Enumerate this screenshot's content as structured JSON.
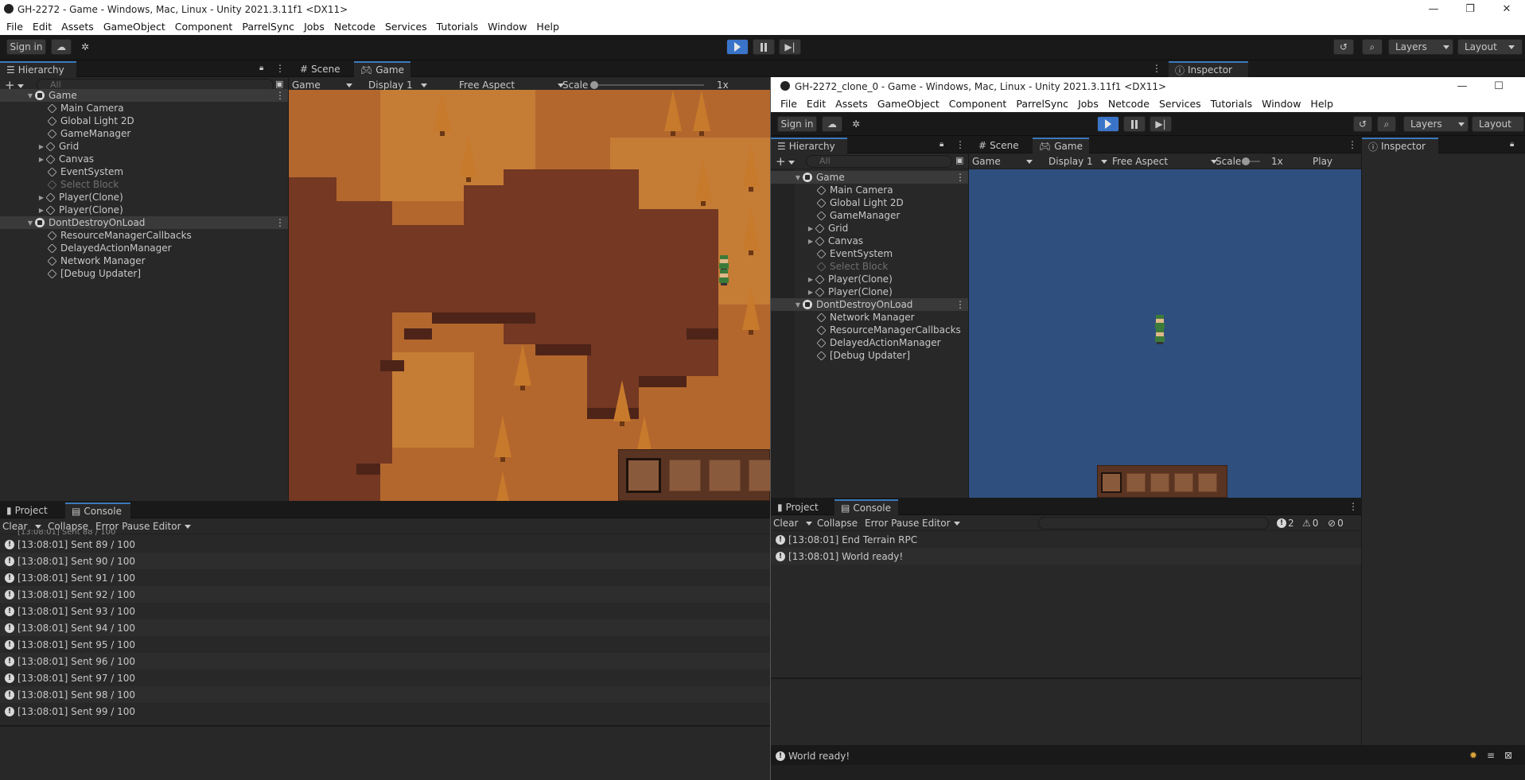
{
  "main_window": {
    "title": "GH-2272 - Game - Windows, Mac, Linux - Unity 2021.3.11f1 <DX11>",
    "menu": [
      "File",
      "Edit",
      "Assets",
      "GameObject",
      "Component",
      "ParrelSync",
      "Jobs",
      "Netcode",
      "Services",
      "Tutorials",
      "Window",
      "Help"
    ],
    "toolbar": {
      "sign_in": "Sign in",
      "layers": "Layers",
      "layout": "Layout"
    },
    "hierarchy": {
      "tab": "Hierarchy",
      "search_placeholder": "All",
      "items": [
        {
          "label": "Game",
          "kind": "scene",
          "expanded": true
        },
        {
          "label": "Main Camera",
          "kind": "object"
        },
        {
          "label": "Global Light 2D",
          "kind": "object"
        },
        {
          "label": "GameManager",
          "kind": "object"
        },
        {
          "label": "Grid",
          "kind": "object",
          "has_children": true
        },
        {
          "label": "Canvas",
          "kind": "object",
          "has_children": true
        },
        {
          "label": "EventSystem",
          "kind": "object"
        },
        {
          "label": "Select Block",
          "kind": "object",
          "disabled": true
        },
        {
          "label": "Player(Clone)",
          "kind": "object",
          "has_children": true
        },
        {
          "label": "Player(Clone)",
          "kind": "object",
          "has_children": true
        },
        {
          "label": "DontDestroyOnLoad",
          "kind": "scene",
          "expanded": true
        },
        {
          "label": "ResourceManagerCallbacks",
          "kind": "object"
        },
        {
          "label": "DelayedActionManager",
          "kind": "object"
        },
        {
          "label": "Network Manager",
          "kind": "object"
        },
        {
          "label": "[Debug Updater]",
          "kind": "object"
        }
      ]
    },
    "game_view": {
      "tabs": [
        "Scene",
        "Game"
      ],
      "active_tab": "Game",
      "view_dropdown": "Game",
      "display": "Display 1",
      "aspect": "Free Aspect",
      "scale_label": "Scale",
      "scale_value": "1x"
    },
    "inspector_tab": "Inspector",
    "bottom": {
      "tabs": [
        "Project",
        "Console"
      ],
      "active_tab": "Console",
      "toolbar": {
        "clear": "Clear",
        "collapse": "Collapse",
        "error_pause": "Error Pause",
        "editor": "Editor"
      },
      "partial_row": "[13:08:01] Sent 88 / 100",
      "log": [
        "[13:08:01] Sent 89 / 100",
        "[13:08:01] Sent 90 / 100",
        "[13:08:01] Sent 91 / 100",
        "[13:08:01] Sent 92 / 100",
        "[13:08:01] Sent 93 / 100",
        "[13:08:01] Sent 94 / 100",
        "[13:08:01] Sent 95 / 100",
        "[13:08:01] Sent 96 / 100",
        "[13:08:01] Sent 97 / 100",
        "[13:08:01] Sent 98 / 100",
        "[13:08:01] Sent 99 / 100"
      ]
    }
  },
  "clone_window": {
    "title": "GH-2272_clone_0 - Game - Windows, Mac, Linux - Unity 2021.3.11f1 <DX11>",
    "menu": [
      "File",
      "Edit",
      "Assets",
      "GameObject",
      "Component",
      "ParrelSync",
      "Jobs",
      "Netcode",
      "Services",
      "Tutorials",
      "Window",
      "Help"
    ],
    "toolbar": {
      "sign_in": "Sign in",
      "layers": "Layers",
      "layout": "Layout"
    },
    "hierarchy": {
      "tab": "Hierarchy",
      "search_placeholder": "All",
      "items": [
        {
          "label": "Game",
          "kind": "scene",
          "expanded": true
        },
        {
          "label": "Main Camera",
          "kind": "object"
        },
        {
          "label": "Global Light 2D",
          "kind": "object"
        },
        {
          "label": "GameManager",
          "kind": "object"
        },
        {
          "label": "Grid",
          "kind": "object",
          "has_children": true
        },
        {
          "label": "Canvas",
          "kind": "object",
          "has_children": true
        },
        {
          "label": "EventSystem",
          "kind": "object"
        },
        {
          "label": "Select Block",
          "kind": "object",
          "disabled": true
        },
        {
          "label": "Player(Clone)",
          "kind": "object",
          "has_children": true
        },
        {
          "label": "Player(Clone)",
          "kind": "object",
          "has_children": true
        },
        {
          "label": "DontDestroyOnLoad",
          "kind": "scene",
          "expanded": true
        },
        {
          "label": "Network Manager",
          "kind": "object"
        },
        {
          "label": "ResourceManagerCallbacks",
          "kind": "object"
        },
        {
          "label": "DelayedActionManager",
          "kind": "object"
        },
        {
          "label": "[Debug Updater]",
          "kind": "object"
        }
      ]
    },
    "game_view": {
      "tabs": [
        "Scene",
        "Game"
      ],
      "active_tab": "Game",
      "view_dropdown": "Game",
      "display": "Display 1",
      "aspect": "Free Aspect",
      "scale_label": "Scale",
      "scale_value": "1x",
      "play_label": "Play",
      "background": "#2f4f7e"
    },
    "inspector_tab": "Inspector",
    "bottom": {
      "tabs": [
        "Project",
        "Console"
      ],
      "active_tab": "Console",
      "toolbar": {
        "clear": "Clear",
        "collapse": "Collapse",
        "error_pause": "Error Pause",
        "editor": "Editor"
      },
      "counts": {
        "info": "2",
        "warnings": "0",
        "errors": "0"
      },
      "log": [
        "[13:08:01] End Terrain RPC",
        "[13:08:01] World ready!"
      ]
    },
    "status": "World ready!"
  },
  "colors": {
    "accent": "#3a79bb",
    "play": "#3a74c9",
    "ground": "#b3672d",
    "water_bg": "#2f4f7e"
  }
}
